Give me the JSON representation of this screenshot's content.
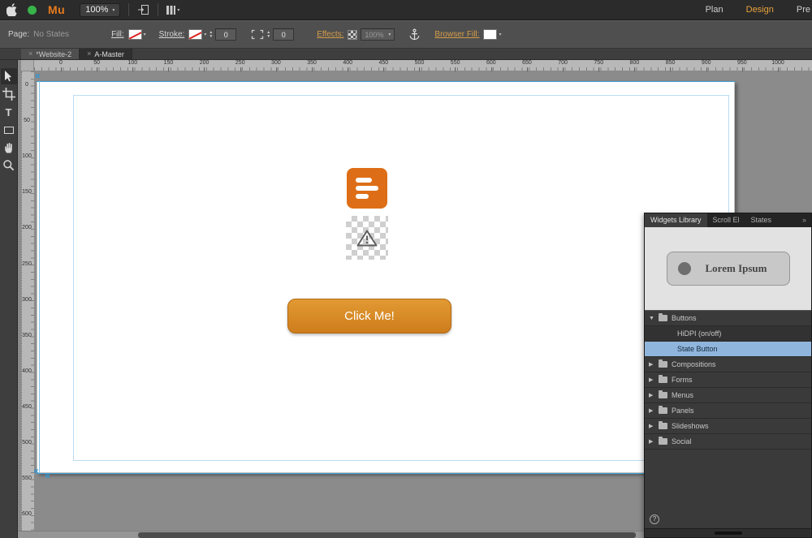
{
  "colors": {
    "accent_orange": "#DD6E17",
    "selection_blue": "#8FB5DC",
    "guide_blue": "#2E96D5"
  },
  "icons": {
    "dropdown": "▾",
    "disclosure_open": "▼",
    "disclosure_closed": "▶",
    "close": "×",
    "guide_handle": "«",
    "overflow": "»",
    "help": "?",
    "stepper_up": "▲",
    "stepper_down": "▼",
    "text_tool": "T"
  },
  "menubar": {
    "logo": "Mu",
    "zoom": "100%",
    "modes": [
      {
        "label": "Plan",
        "active": false
      },
      {
        "label": "Design",
        "active": true
      },
      {
        "label": "Pre",
        "active": false
      }
    ]
  },
  "control_bar": {
    "page_label": "Page:",
    "page_value": "No States",
    "fill_label": "Fill:",
    "stroke_label": "Stroke:",
    "stroke_weight": "0",
    "corner_radius": "0",
    "effects_label": "Effects:",
    "effects_value": "100%",
    "browser_fill_label": "Browser Fill:"
  },
  "tabs": [
    {
      "label": "*Website-2",
      "active": false
    },
    {
      "label": "A-Master",
      "active": true
    }
  ],
  "tools": [
    "selection",
    "crop",
    "text",
    "rectangle",
    "hand",
    "zoom"
  ],
  "rulers": {
    "horizontal": [
      "0",
      "50",
      "100",
      "150",
      "200",
      "250",
      "300",
      "350",
      "400",
      "450",
      "500",
      "550",
      "600",
      "650",
      "700",
      "750",
      "800",
      "850",
      "900",
      "950",
      "1000"
    ],
    "vertical": [
      "0",
      "50",
      "100",
      "150",
      "200",
      "250",
      "300",
      "350",
      "400",
      "450",
      "500",
      "550",
      "600"
    ]
  },
  "canvas": {
    "button_label": "Click Me!"
  },
  "widgets_panel": {
    "tabs": [
      {
        "label": "Widgets Library",
        "active": true
      },
      {
        "label": "Scroll El",
        "active": false
      },
      {
        "label": "States",
        "active": false
      }
    ],
    "preview_button_label": "Lorem Ipsum",
    "tree": [
      {
        "label": "Buttons",
        "kind": "folder",
        "expanded": true
      },
      {
        "label": "HiDPI (on/off)",
        "kind": "item",
        "selected": false
      },
      {
        "label": "State Button",
        "kind": "item",
        "selected": true
      },
      {
        "label": "Compositions",
        "kind": "folder",
        "expanded": false
      },
      {
        "label": "Forms",
        "kind": "folder",
        "expanded": false
      },
      {
        "label": "Menus",
        "kind": "folder",
        "expanded": false
      },
      {
        "label": "Panels",
        "kind": "folder",
        "expanded": false
      },
      {
        "label": "Slideshows",
        "kind": "folder",
        "expanded": false
      },
      {
        "label": "Social",
        "kind": "folder",
        "expanded": false
      }
    ]
  }
}
